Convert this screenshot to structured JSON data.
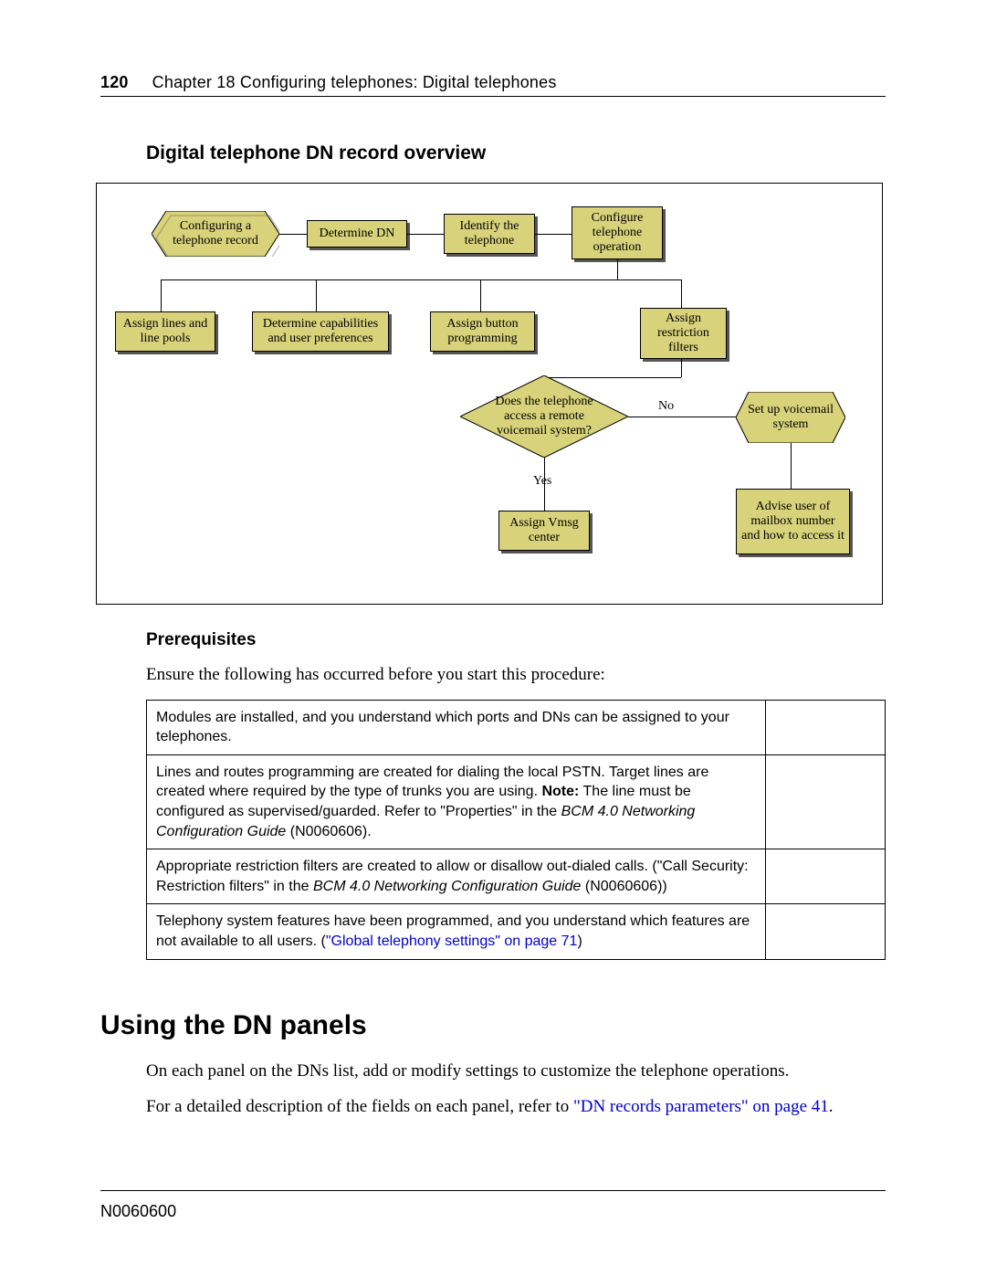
{
  "header": {
    "page_number": "120",
    "chapter": "Chapter 18  Configuring telephones: Digital telephones"
  },
  "section_title": "Digital telephone DN record overview",
  "flow": {
    "n_configuring": "Configuring a telephone record",
    "n_determine_dn": "Determine DN",
    "n_identify": "Identify the telephone",
    "n_config_op": "Configure telephone operation",
    "n_assign_lines": "Assign lines and line pools",
    "n_capabilities": "Determine capabilities and user preferences",
    "n_button": "Assign button programming",
    "n_restriction": "Assign restriction filters",
    "decision": "Does the telephone access a remote voicemail system?",
    "edge_no": "No",
    "edge_yes": "Yes",
    "n_setup_vm": "Set up voicemail system",
    "n_vmsg_center": "Assign Vmsg center",
    "n_advise": "Advise user of mailbox number and how to access it"
  },
  "prereq_heading": "Prerequisites",
  "prereq_intro": "Ensure the following has occurred before you start this procedure:",
  "table_rows": {
    "r1": "Modules are installed, and you understand which ports and DNs can be assigned to your telephones.",
    "r2_a": "Lines and routes programming are created for dialing the local PSTN. Target lines are created where required by the type of trunks you are using. ",
    "r2_note_label": "Note:",
    "r2_b": " The line must be configured as supervised/guarded. Refer to \"Properties\" in the ",
    "r2_i": "BCM 4.0 Networking Configuration Guide",
    "r2_c": " (N0060606).",
    "r3_a": "Appropriate restriction filters are created to allow or disallow out-dialed calls. (\"Call Security: Restriction filters\" in the ",
    "r3_i": "BCM 4.0 Networking Configuration Guide",
    "r3_b": " (N0060606))",
    "r4_a": "Telephony system features have been programmed, and you understand which features are not available to all users. (",
    "r4_link": "\"Global telephony settings\" on page 71",
    "r4_b": ")"
  },
  "h2": "Using the DN panels",
  "p1": "On each panel on the DNs list, add or modify settings to customize the telephone operations.",
  "p2_a": "For a detailed description of the fields on each panel, refer to ",
  "p2_link": "\"DN records parameters\" on page 41",
  "p2_b": ".",
  "footer": "N0060600",
  "chart_data": {
    "type": "flowchart",
    "nodes": [
      {
        "id": "configuring",
        "shape": "hexagon",
        "label": "Configuring a telephone record"
      },
      {
        "id": "determine_dn",
        "shape": "rect",
        "label": "Determine DN"
      },
      {
        "id": "identify",
        "shape": "rect",
        "label": "Identify the telephone"
      },
      {
        "id": "config_op",
        "shape": "rect",
        "label": "Configure telephone operation"
      },
      {
        "id": "assign_lines",
        "shape": "rect",
        "label": "Assign lines and line pools"
      },
      {
        "id": "capabilities",
        "shape": "rect",
        "label": "Determine capabilities and user preferences"
      },
      {
        "id": "button",
        "shape": "rect",
        "label": "Assign button programming"
      },
      {
        "id": "restriction",
        "shape": "rect",
        "label": "Assign restriction filters"
      },
      {
        "id": "decision",
        "shape": "diamond",
        "label": "Does the telephone access a remote voicemail system?"
      },
      {
        "id": "setup_vm",
        "shape": "hexagon",
        "label": "Set up voicemail system"
      },
      {
        "id": "vmsg_center",
        "shape": "rect",
        "label": "Assign Vmsg center"
      },
      {
        "id": "advise",
        "shape": "rect",
        "label": "Advise user of mailbox number and how to access it"
      }
    ],
    "edges": [
      {
        "from": "configuring",
        "to": "determine_dn"
      },
      {
        "from": "determine_dn",
        "to": "identify"
      },
      {
        "from": "identify",
        "to": "config_op"
      },
      {
        "from": "config_op",
        "to": "assign_lines"
      },
      {
        "from": "config_op",
        "to": "capabilities"
      },
      {
        "from": "config_op",
        "to": "button"
      },
      {
        "from": "config_op",
        "to": "restriction"
      },
      {
        "from": "restriction",
        "to": "decision"
      },
      {
        "from": "decision",
        "to": "setup_vm",
        "label": "No"
      },
      {
        "from": "decision",
        "to": "vmsg_center",
        "label": "Yes"
      },
      {
        "from": "setup_vm",
        "to": "advise"
      }
    ]
  }
}
